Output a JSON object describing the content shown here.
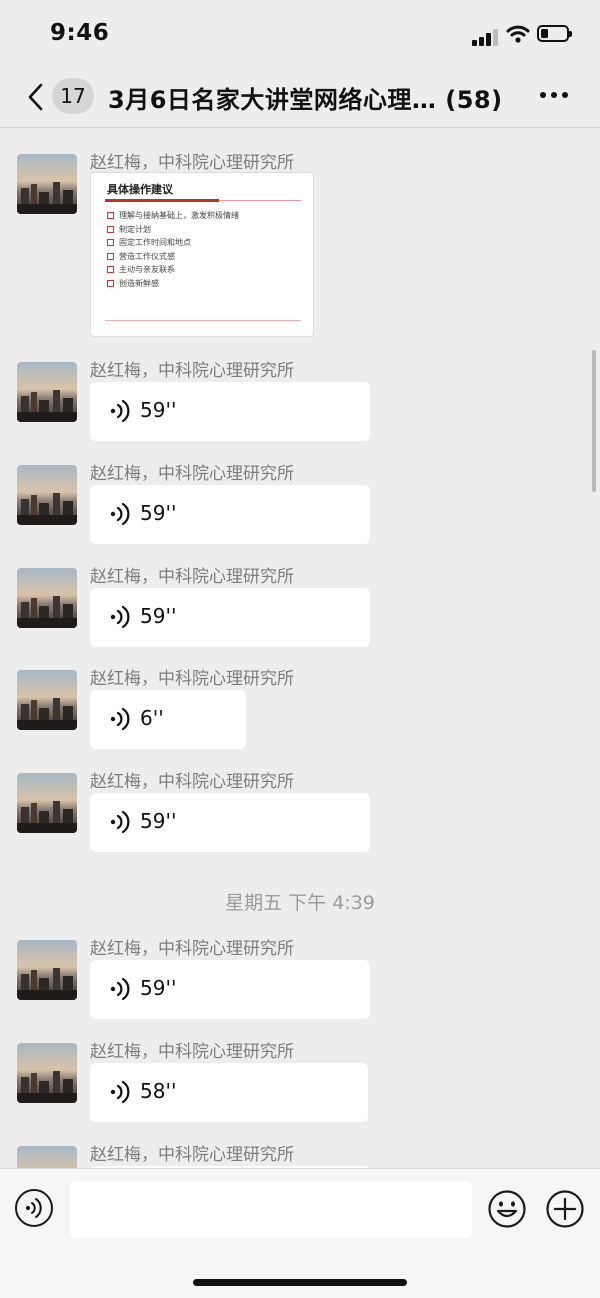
{
  "status_bar": {
    "time": "9:46"
  },
  "nav": {
    "unread_count": "17",
    "title": "3月6日名家大讲堂网络心理…  (58)"
  },
  "sender_name": "赵红梅，中科院心理研究所",
  "slide": {
    "title": "具体操作建议",
    "items": [
      "理解与接纳基础上，激发积极情绪",
      "制定计划",
      "固定工作时间和地点",
      "营造工作仪式感",
      "主动与亲友联系",
      "创造新鲜感"
    ]
  },
  "messages": [
    {
      "type": "voice",
      "duration": "59''"
    },
    {
      "type": "voice",
      "duration": "59''"
    },
    {
      "type": "voice",
      "duration": "59''"
    },
    {
      "type": "voice",
      "duration": "6''"
    },
    {
      "type": "voice",
      "duration": "59''"
    },
    {
      "type": "voice",
      "duration": "59''"
    },
    {
      "type": "voice",
      "duration": "58''"
    }
  ],
  "timestamp": "星期五 下午 4:39",
  "input": {
    "placeholder": ""
  },
  "icons": {
    "back": "chevron-left-icon",
    "more": "more-dots-icon",
    "voice": "voice-wave-icon",
    "emoji": "emoji-face-icon",
    "plus": "plus-circle-icon"
  }
}
